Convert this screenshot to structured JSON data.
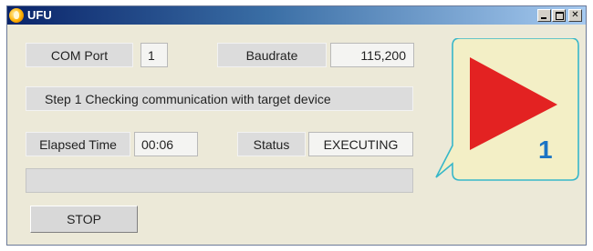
{
  "window": {
    "title": "UFU"
  },
  "com_port": {
    "label": "COM Port",
    "value": "1"
  },
  "baudrate": {
    "label": "Baudrate",
    "value": "115,200"
  },
  "step_message": "Step 1   Checking communication with target device",
  "elapsed_time": {
    "label": "Elapsed Time",
    "value": "00:06"
  },
  "status": {
    "label": "Status",
    "value": "EXECUTING"
  },
  "progress": {
    "value": 0
  },
  "stop_button": {
    "label": "STOP"
  },
  "indicator": {
    "step": "1",
    "state": "play-icon"
  },
  "colors": {
    "indicator_bg": "#f3efc6",
    "indicator_border": "#37b7c9",
    "play": "#e32222",
    "step_number": "#1b74c4"
  }
}
